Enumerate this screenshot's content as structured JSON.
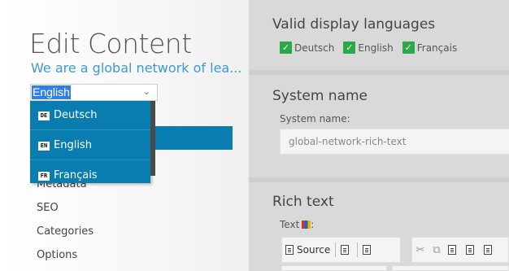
{
  "left": {
    "title": "Edit Content",
    "subtitle": "We are a global network of lea...",
    "language_select": {
      "selected": "English"
    },
    "dropdown_options": [
      {
        "code": "DE",
        "label": "Deutsch"
      },
      {
        "code": "EN",
        "label": "English"
      },
      {
        "code": "FR",
        "label": "Français"
      }
    ],
    "nav": {
      "metadata": "Metadata",
      "seo": "SEO",
      "categories": "Categories",
      "options": "Options"
    }
  },
  "right": {
    "valid_languages": {
      "heading": "Valid display languages",
      "items": [
        "Deutsch",
        "English",
        "Français"
      ]
    },
    "system_name": {
      "heading": "System name",
      "label": "System name:",
      "value": "global-network-rich-text"
    },
    "rich_text": {
      "heading": "Rich text",
      "label": "Text",
      "label_suffix": ":",
      "toolbar": {
        "source_label": "Source"
      }
    }
  },
  "colors": {
    "accent_blue": "#0a7db0",
    "subtitle_blue": "#3b9bd1",
    "check_green": "#2ba84a",
    "panel_grey": "#d9d9d9"
  }
}
